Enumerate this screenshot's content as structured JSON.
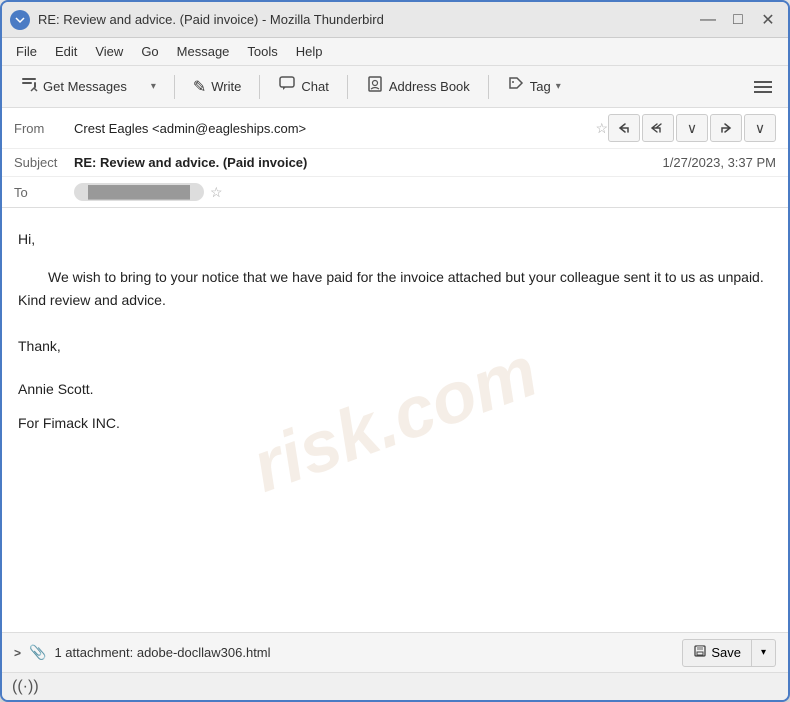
{
  "window": {
    "title": "RE: Review and advice. (Paid invoice) - Mozilla Thunderbird",
    "icon": "🐦"
  },
  "titlebar": {
    "controls": {
      "minimize": "—",
      "maximize": "□",
      "close": "✕"
    }
  },
  "menubar": {
    "items": [
      "File",
      "Edit",
      "View",
      "Go",
      "Message",
      "Tools",
      "Help"
    ]
  },
  "toolbar": {
    "get_messages_label": "Get Messages",
    "write_label": "Write",
    "chat_label": "Chat",
    "address_book_label": "Address Book",
    "tag_label": "Tag",
    "get_messages_icon": "⬇",
    "write_icon": "✎",
    "chat_icon": "💬",
    "address_book_icon": "👤",
    "tag_icon": "🏷"
  },
  "email": {
    "from_label": "From",
    "from_value": "Crest Eagles <admin@eagleships.com>",
    "subject_label": "Subject",
    "subject_value": "RE: Review and advice. (Paid invoice)",
    "date_value": "1/27/2023, 3:37 PM",
    "to_label": "To",
    "to_value": "████████████",
    "body_greeting": "Hi,",
    "body_paragraph": "We wish to bring to your notice that we have paid for the invoice attached but your colleague sent it to us as unpaid. Kind review and advice.",
    "body_closing": "Thank,",
    "body_signature_line1": "Annie Scott.",
    "body_signature_line2": "For Fimack INC.",
    "watermark": "risk.com"
  },
  "attachment": {
    "expand_label": ">",
    "count_text": "1 attachment: adobe-docllaw306.html",
    "save_label": "Save"
  },
  "statusbar": {
    "icon": "((·))"
  },
  "action_buttons": {
    "reply": "↩",
    "reply_all": "↩",
    "more_reply": "∨",
    "forward": "→",
    "more_forward": "∨"
  }
}
